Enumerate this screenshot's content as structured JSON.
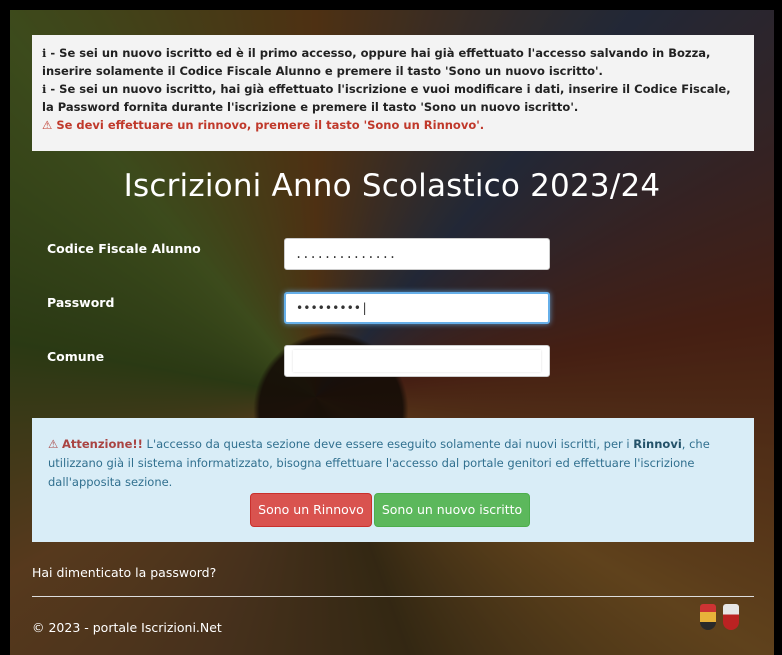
{
  "info": {
    "line1_prefix": "i",
    "line1": " - Se sei un nuovo iscritto ed è il primo accesso, oppure hai già effettuato l'accesso salvando in Bozza, inserire solamente il Codice Fiscale Alunno e premere il tasto 'Sono un nuovo iscritto'.",
    "line2_prefix": "i",
    "line2": " - Se sei un nuovo iscritto, hai già effettuato l'iscrizione e vuoi modificare i dati, inserire il Codice Fiscale, la Password fornita durante l'iscrizione e premere il tasto 'Sono un nuovo iscritto'.",
    "warning_icon": "⚠",
    "warning": " Se devi effettuare un rinnovo, premere il tasto 'Sono un Rinnovo'."
  },
  "title": "Iscrizioni Anno Scolastico 2023/24",
  "form": {
    "codice_label": "Codice Fiscale Alunno",
    "codice_value": "..............",
    "password_label": "Password",
    "password_value": "•••••••••|",
    "comune_label": "Comune",
    "comune_value": ""
  },
  "notice": {
    "icon": "⚠",
    "attention": "Attenzione!!",
    "text_a": " L'accesso da questa sezione deve essere eseguito solamente dai nuovi iscritti, per i ",
    "rinnovi": "Rinnovi",
    "text_b": ", che utilizzano già il sistema informatizzato, bisogna effettuare l'accesso dal portale genitori ed effettuare l'iscrizione dall'apposita sezione."
  },
  "buttons": {
    "rinnovo": "Sono un Rinnovo",
    "nuovo": "Sono un nuovo iscritto"
  },
  "forgot": "Hai dimenticato la password?",
  "footer": "© 2023 - portale Iscrizioni.Net",
  "colors": {
    "danger": "#d9534f",
    "success": "#5cb85c",
    "info_bg": "#d9edf7"
  }
}
